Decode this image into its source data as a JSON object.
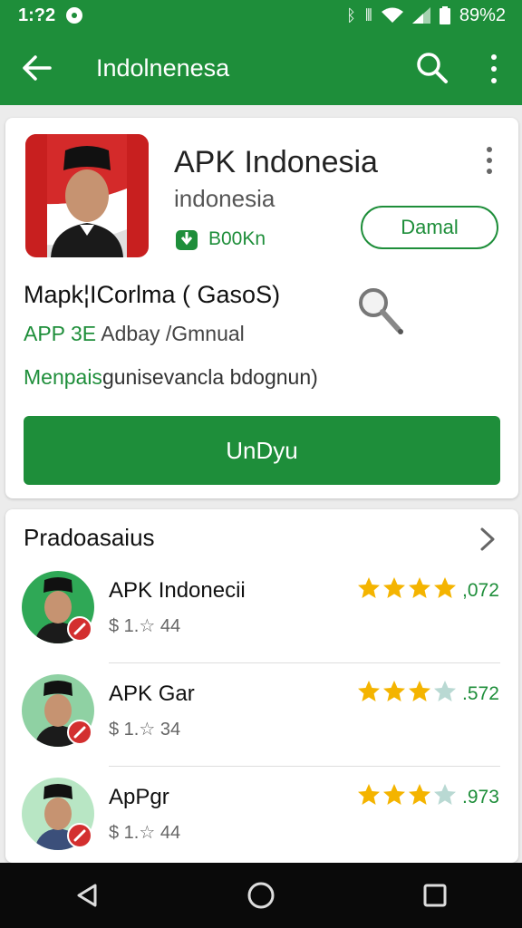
{
  "status_bar": {
    "time": "1:?2",
    "battery": "89%2",
    "icons": [
      "bluetooth-icon",
      "vibrate-icon",
      "wifi-icon",
      "signal-icon",
      "battery-icon"
    ]
  },
  "app_bar": {
    "title": "Indolnenesa",
    "icons": [
      "back-arrow-icon",
      "search-icon",
      "more-vert-icon"
    ]
  },
  "app_card": {
    "name": "APK Indonesia",
    "subtitle": "indonesia",
    "downloads": "B00Kn",
    "detail_button": "Damal",
    "row_title": "Mapk¦ICorlma ( GasoS)",
    "meta_accent": "APP 3E",
    "meta_text": "Adbay /Gmnual",
    "desc_accent": "Menpais",
    "desc_text": "gunisevancla bdognun)",
    "download_button": "UnDyu"
  },
  "list": {
    "header": "Pradoasaius",
    "items": [
      {
        "name": "APK Indonecii",
        "price": "$ 1.☆ 44",
        "stars": 4.5,
        "rating": ",072"
      },
      {
        "name": "APK Gar",
        "price": "$ 1.☆ 34",
        "stars": 3,
        "rating": ".572"
      },
      {
        "name": "ApPgr",
        "price": "$ 1.☆ 44",
        "stars": 3,
        "rating": ".973"
      }
    ]
  },
  "colors": {
    "primary": "#1e8e3a",
    "star": "#f4b400",
    "star_empty": "#b9d9d3",
    "badge": "#d32f2f"
  }
}
